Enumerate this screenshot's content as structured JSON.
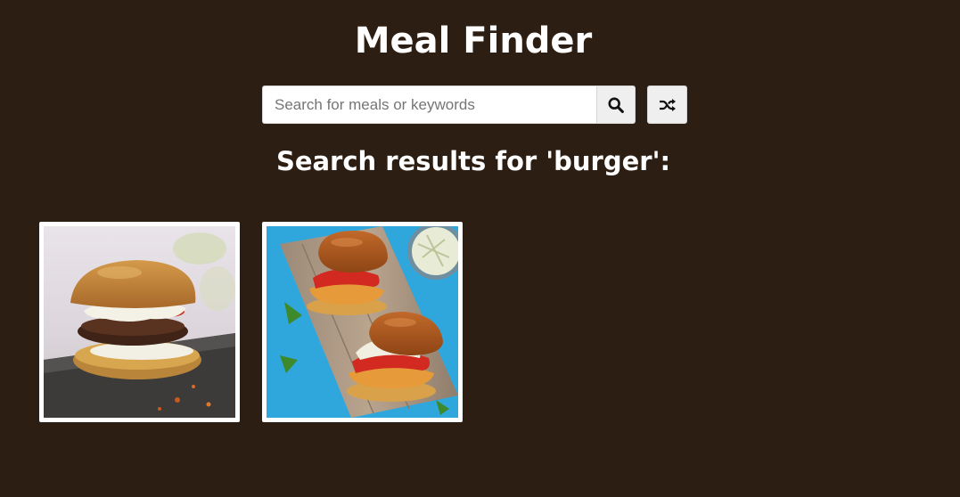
{
  "app": {
    "title": "Meal Finder"
  },
  "search": {
    "placeholder": "Search for meals or keywords",
    "value": "",
    "submit_icon": "search-icon",
    "random_icon": "shuffle-icon"
  },
  "results": {
    "heading": "Search results for 'burger':",
    "meals": [
      {
        "image": "burger-with-white-sauce-on-slate"
      },
      {
        "image": "two-chicken-burgers-on-wooden-board"
      }
    ]
  }
}
